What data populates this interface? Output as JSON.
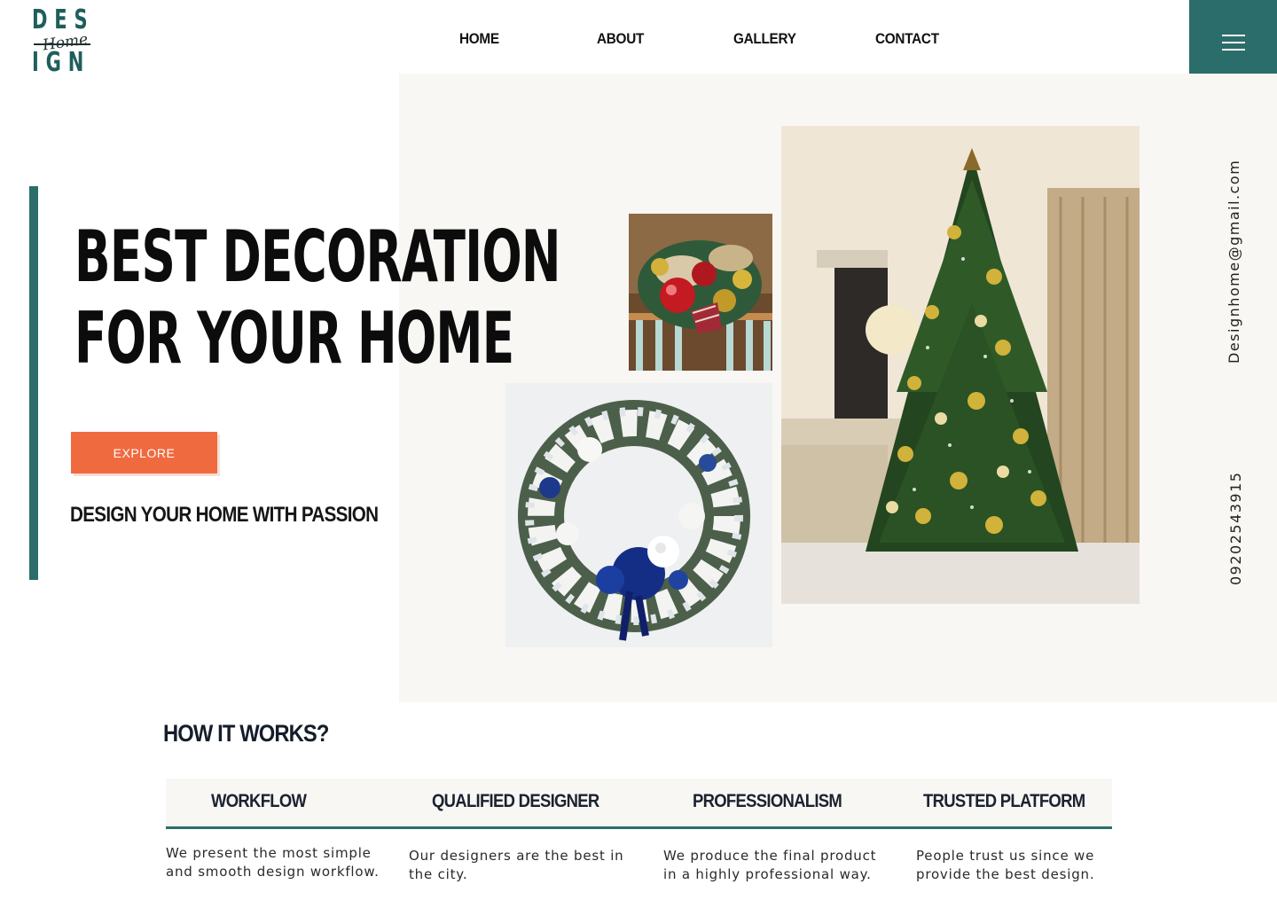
{
  "brand": {
    "logo_top": "DES",
    "logo_script": "Home",
    "logo_bottom": "IGN",
    "primary_color": "#2b6d6a",
    "accent_color": "#f06a40"
  },
  "nav": {
    "items": [
      {
        "label": "HOME"
      },
      {
        "label": "ABOUT"
      },
      {
        "label": "GALLERY"
      },
      {
        "label": "CONTACT"
      }
    ],
    "menu_icon": "hamburger-menu-icon"
  },
  "hero": {
    "title_line1": "BEST DECORATION",
    "title_line2": "FOR YOUR HOME",
    "cta_label": "EXPLORE",
    "tagline": "DESIGN YOUR HOME WITH PASSION"
  },
  "contact": {
    "email": "Designhome@gmail.com",
    "phone": "09202543915"
  },
  "how_it_works": {
    "title": "HOW IT WORKS?",
    "features": [
      {
        "title": "WORKFLOW",
        "desc_line1": "We present the most simple",
        "desc_line2": "and smooth design workflow."
      },
      {
        "title": "QUALIFIED DESIGNER",
        "desc_line1": "Our designers are the best in",
        "desc_line2": "the city."
      },
      {
        "title": "PROFESSIONALISM",
        "desc_line1": "We produce the final product",
        "desc_line2": "in a highly professional way."
      },
      {
        "title": "TRUSTED PLATFORM",
        "desc_line1": "People trust us since we",
        "desc_line2": "provide the best design."
      }
    ]
  }
}
